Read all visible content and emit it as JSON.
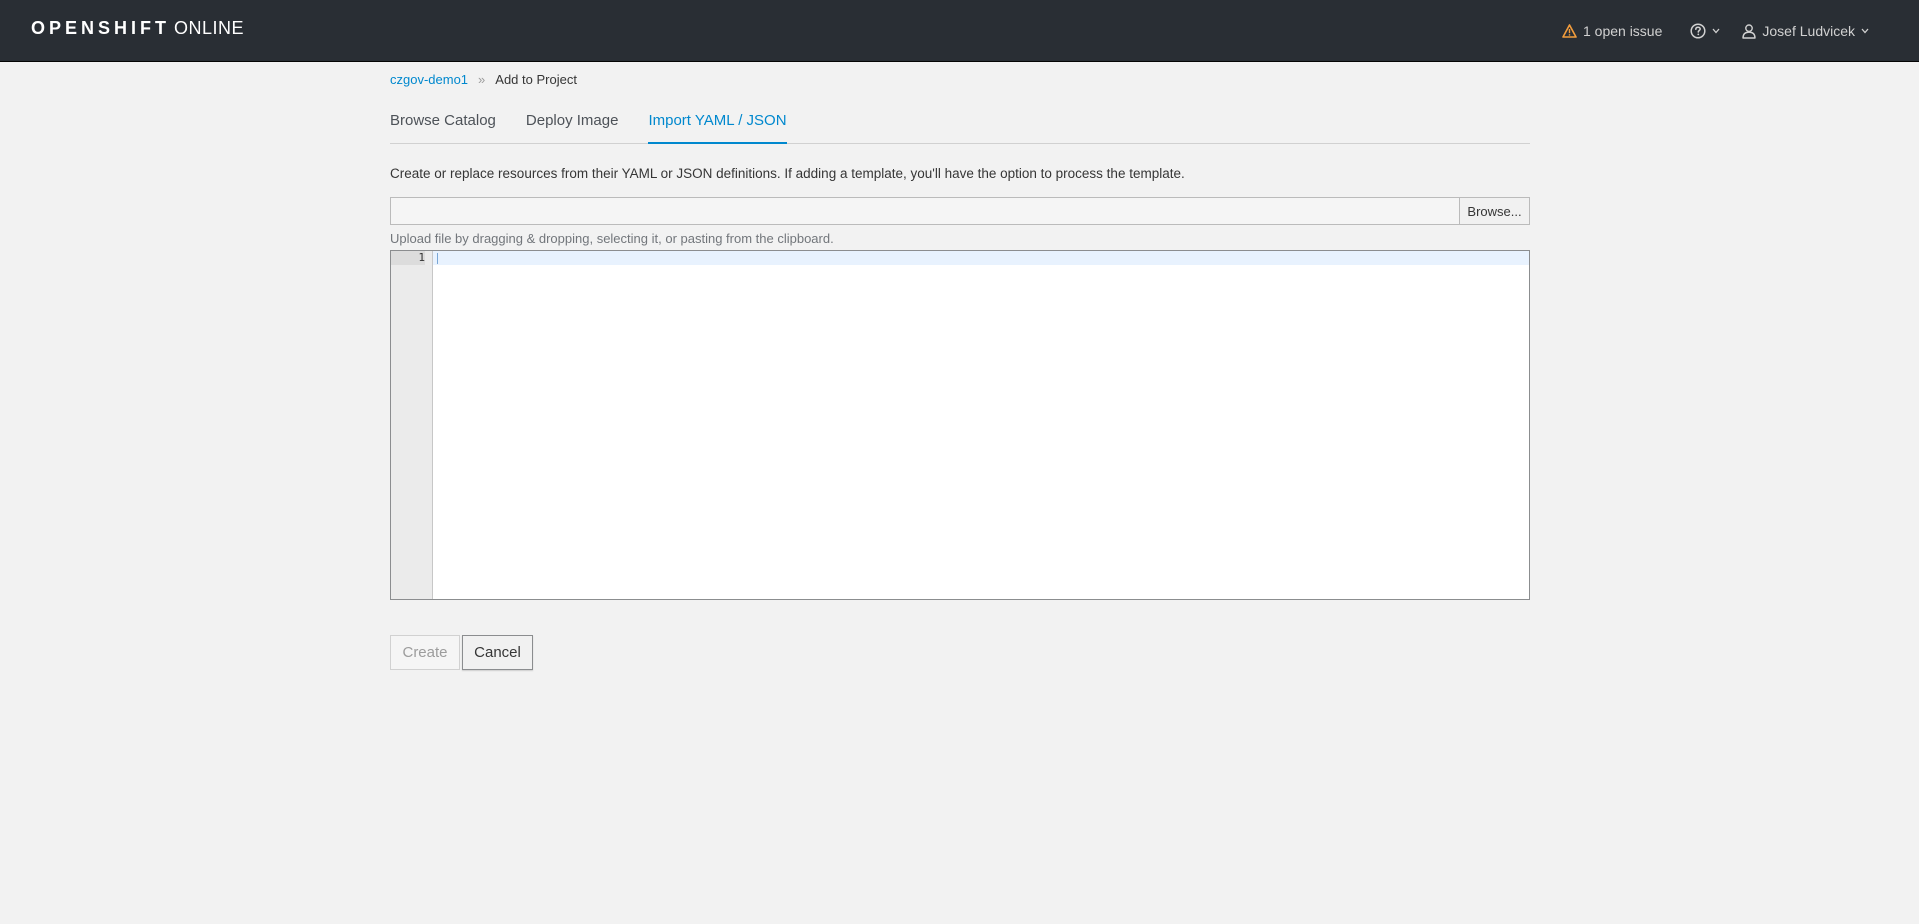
{
  "header": {
    "brand_main": "OPENSHIFT",
    "brand_sub": "ONLINE",
    "issues_label": "1 open issue",
    "user_name": "Josef Ludvicek",
    "warning_color": "#f39d3c"
  },
  "breadcrumb": {
    "project": "czgov-demo1",
    "separator": "»",
    "current": "Add to Project"
  },
  "tabs": [
    {
      "label": "Browse Catalog"
    },
    {
      "label": "Deploy Image"
    },
    {
      "label": "Import YAML / JSON",
      "active": true
    }
  ],
  "main": {
    "description": "Create or replace resources from their YAML or JSON definitions. If adding a template, you'll have the option to process the template.",
    "file_input_value": "",
    "browse_label": "Browse...",
    "upload_hint": "Upload file by dragging & dropping, selecting it, or pasting from the clipboard.",
    "editor_line_number": "1"
  },
  "actions": {
    "create_label": "Create",
    "cancel_label": "Cancel"
  }
}
